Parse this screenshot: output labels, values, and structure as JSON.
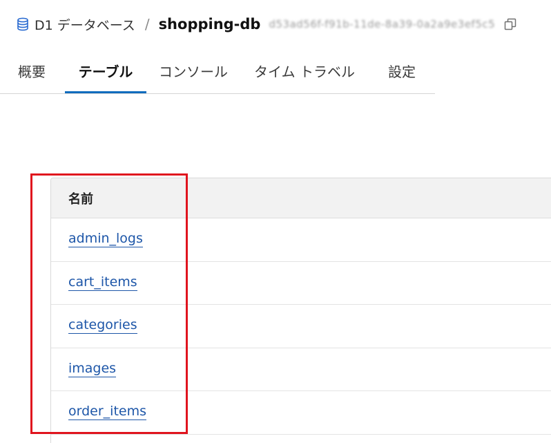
{
  "breadcrumb": {
    "icon": "database-icon",
    "parent": "D1 データベース",
    "separator": "/",
    "current": "shopping-db",
    "database_id": "d53ad56f-f91b-11de-8a39-0a2a9e3ef5c5",
    "copy_icon": "copy-icon"
  },
  "tabs": [
    {
      "label": "概要",
      "active": false
    },
    {
      "label": "テーブル",
      "active": true
    },
    {
      "label": "コンソール",
      "active": false
    },
    {
      "label": "タイム トラベル",
      "active": false
    },
    {
      "label": "設定",
      "active": false
    }
  ],
  "table": {
    "header": "名前",
    "rows": [
      "admin_logs",
      "cart_items",
      "categories",
      "images",
      "order_items"
    ]
  },
  "colors": {
    "accent": "#0f6cbd",
    "link": "#1d56a8",
    "highlight": "#e0141e"
  }
}
